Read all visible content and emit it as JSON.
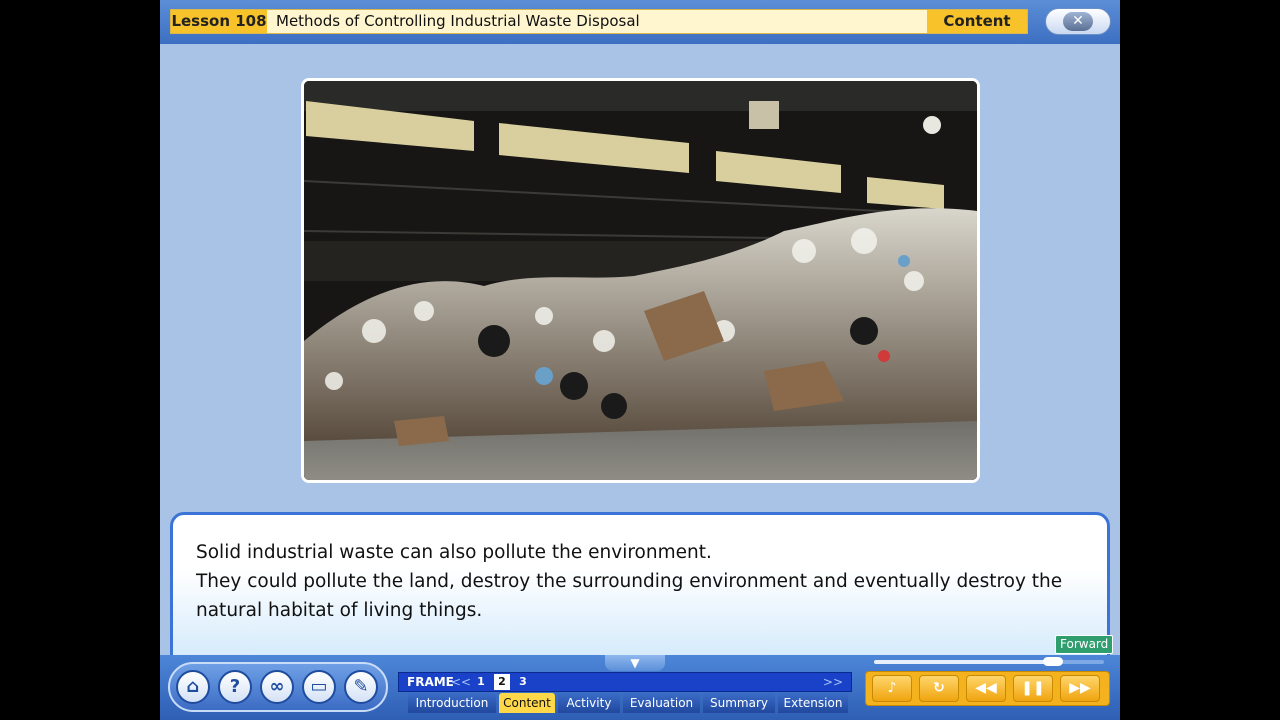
{
  "header": {
    "lesson_tag": "Lesson 108",
    "lesson_title": "Methods of Controlling Industrial Waste Disposal",
    "section_tag": "Content",
    "close_glyph": "✕"
  },
  "narration": {
    "line1": "Solid industrial waste can also pollute the environment.",
    "line2": "They could pollute the land, destroy the surrounding environment and eventually destroy the natural habitat of living things."
  },
  "forward_label": "Forward",
  "frame_nav": {
    "label": "FRAME",
    "prev": "<<",
    "next": ">>",
    "frames": [
      "1",
      "2",
      "3"
    ],
    "current_frame": "2"
  },
  "tabs": [
    "Introduction",
    "Content",
    "Activity",
    "Evaluation",
    "Summary",
    "Extension"
  ],
  "active_tab": "Content",
  "tools": {
    "home": "⌂",
    "help": "?",
    "link": "∞",
    "book": "▭",
    "notes": "✎"
  },
  "media": {
    "sound": "♪",
    "replay": "↻",
    "rewind": "◀◀",
    "pause": "❚❚",
    "forward": "▶▶"
  },
  "progress": {
    "fraction": 0.78
  },
  "colors": {
    "accent": "#f7c22a",
    "frame_bar": "#1942c9",
    "panel_border": "#3b74d6"
  }
}
